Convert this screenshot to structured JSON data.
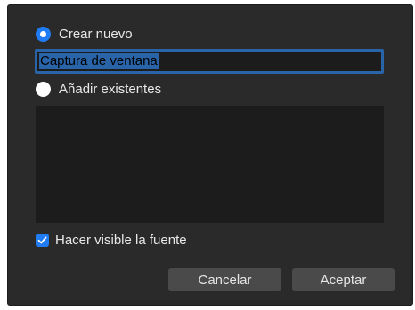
{
  "dialog": {
    "create_new": {
      "label": "Crear nuevo",
      "selected": true
    },
    "name_field": {
      "value": "Captura de ventana"
    },
    "add_existing": {
      "label": "Añadir existentes",
      "selected": false
    },
    "existing_list": {
      "items": []
    },
    "make_visible": {
      "label": "Hacer visible la fuente",
      "checked": true
    },
    "buttons": {
      "cancel": "Cancelar",
      "accept": "Aceptar"
    }
  },
  "colors": {
    "dialog_bg": "#2b2a2b",
    "accent": "#1f7cf5",
    "selection": "#2a64a8",
    "field_bg": "#1c1c1c",
    "button_bg": "#4a4a4a",
    "text": "#e8e8e8"
  }
}
